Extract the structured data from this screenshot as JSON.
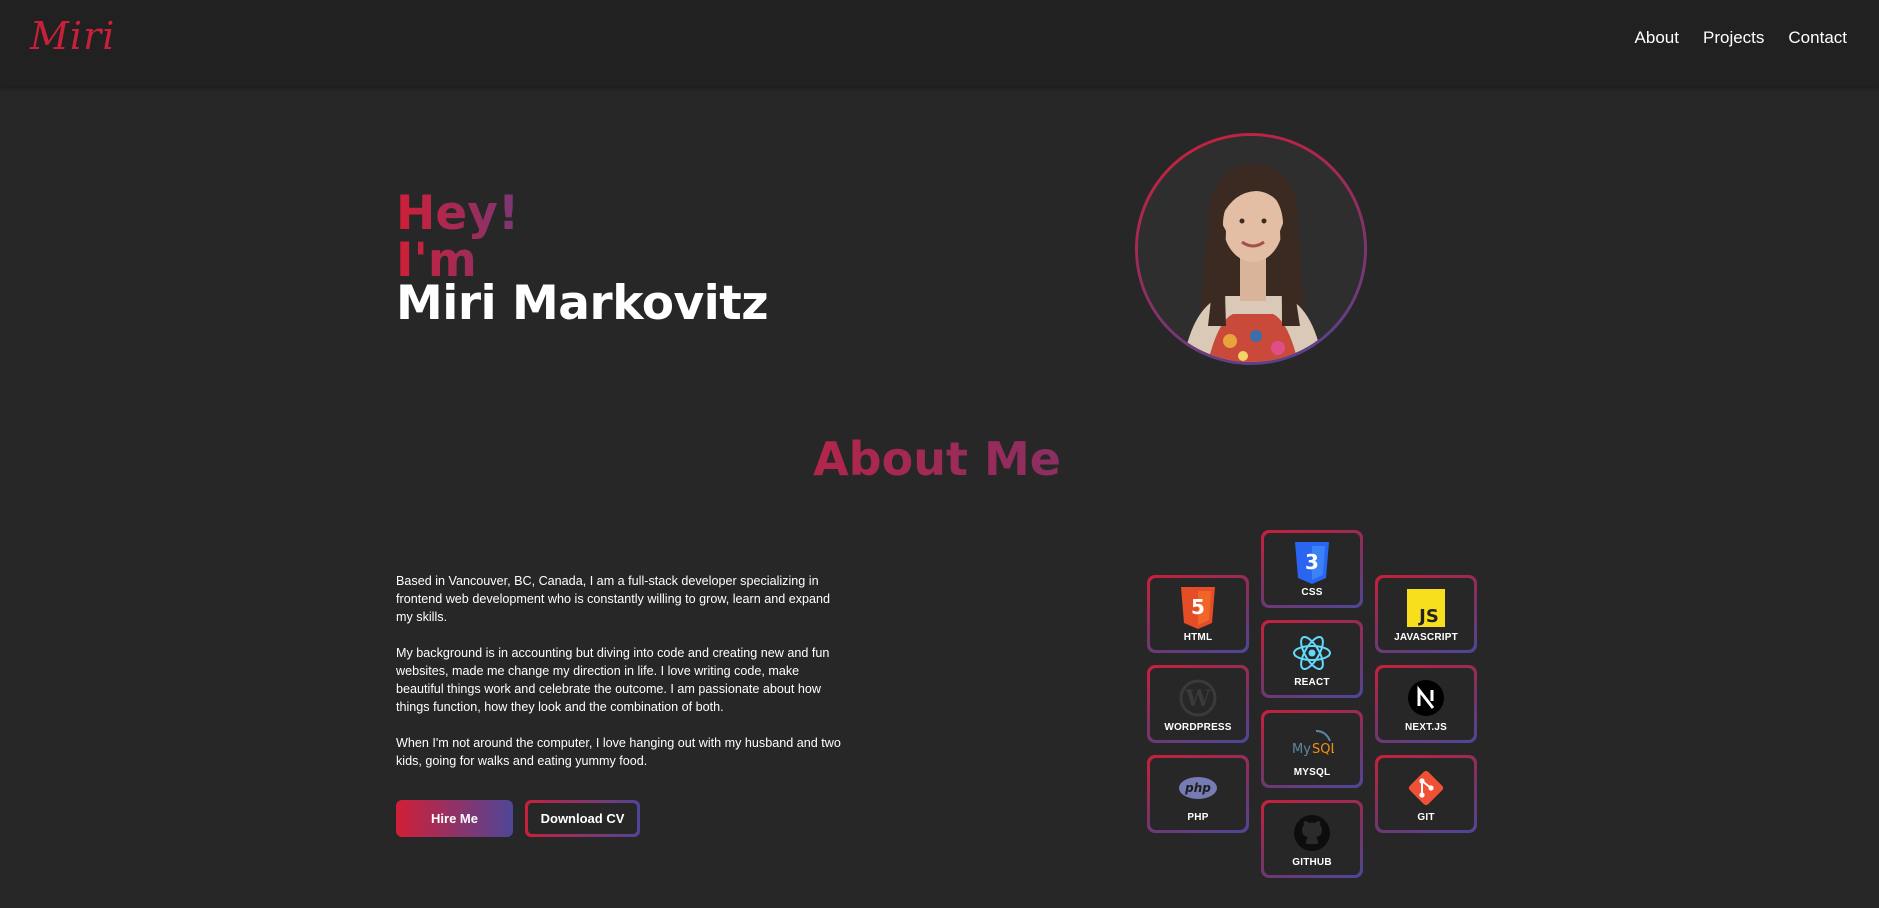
{
  "header": {
    "logo": "Miri",
    "nav": [
      "About",
      "Projects",
      "Contact"
    ]
  },
  "hero": {
    "greeting": "Hey! I'm",
    "name": "Miri Markovitz"
  },
  "about": {
    "title": "About Me",
    "paragraphs": [
      "Based in Vancouver, BC, Canada, I am a full-stack developer specializing in frontend web development who is constantly willing to grow, learn and expand my skills.",
      "My background is in accounting but diving into code and creating new and fun websites, made me change my direction in life. I love writing code, make beautiful things work and celebrate the outcome. I am passionate about how things function, how they look and the combination of both.",
      "When I'm not around the computer, I love hanging out with my husband and two kids, going for walks and eating yummy food."
    ],
    "buttons": {
      "hire": "Hire Me",
      "cv": "Download CV"
    }
  },
  "skills": [
    {
      "label": "CSS",
      "icon": "css3-icon"
    },
    {
      "label": "HTML",
      "icon": "html5-icon"
    },
    {
      "label": "JAVASCRIPT",
      "icon": "javascript-icon"
    },
    {
      "label": "REACT",
      "icon": "react-icon"
    },
    {
      "label": "WORDPRESS",
      "icon": "wordpress-icon"
    },
    {
      "label": "NEXT.JS",
      "icon": "nextjs-icon"
    },
    {
      "label": "MYSQL",
      "icon": "mysql-icon"
    },
    {
      "label": "PHP",
      "icon": "php-icon"
    },
    {
      "label": "GIT",
      "icon": "git-icon"
    },
    {
      "label": "GITHUB",
      "icon": "github-icon"
    }
  ],
  "colors": {
    "accent_red": "#d11f37",
    "accent_purple": "#4f4697",
    "background": "#272727",
    "header": "#212121"
  }
}
